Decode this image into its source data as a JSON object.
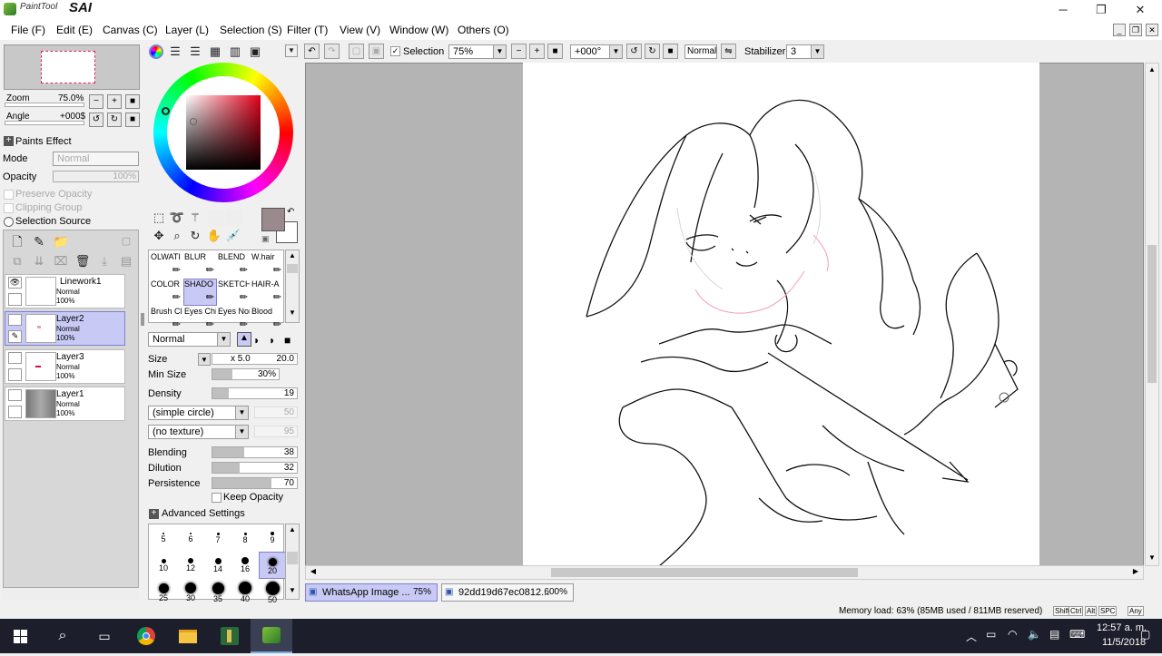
{
  "app": {
    "logo_text": "PaintTool",
    "logo_sai": "SAI"
  },
  "window_controls": {
    "minimize": "─",
    "restore": "❐",
    "close": "✕"
  },
  "menu": [
    {
      "label": "File (F)"
    },
    {
      "label": "Edit (E)"
    },
    {
      "label": "Canvas (C)"
    },
    {
      "label": "Layer (L)"
    },
    {
      "label": "Selection (S)"
    },
    {
      "label": "Filter (T)"
    },
    {
      "label": "View (V)"
    },
    {
      "label": "Window (W)"
    },
    {
      "label": "Others (O)"
    }
  ],
  "navigator": {
    "zoom_label": "Zoom",
    "zoom_value": "75.0%",
    "angle_label": "Angle",
    "angle_value": "+000$"
  },
  "paints_effect": {
    "title": "Paints Effect",
    "mode_label": "Mode",
    "mode_value": "Normal",
    "opacity_label": "Opacity",
    "opacity_value": "100%",
    "preserve_opacity": "Preserve Opacity",
    "clipping_group": "Clipping Group",
    "selection_source": "Selection Source"
  },
  "layers": [
    {
      "name": "Linework1",
      "mode": "Normal",
      "opacity": "100%",
      "selected": false
    },
    {
      "name": "Layer2",
      "mode": "Normal",
      "opacity": "100%",
      "selected": true
    },
    {
      "name": "Layer3",
      "mode": "Normal",
      "opacity": "100%",
      "selected": false
    },
    {
      "name": "Layer1",
      "mode": "Normal",
      "opacity": "100%",
      "selected": false
    }
  ],
  "colors": {
    "primary": "#9a8a8e",
    "secondary": "#ffffff",
    "accent_select": "#c9c9f5",
    "guide_pink": "#e0246a"
  },
  "brushes": [
    [
      "OLWATI",
      "BLUR",
      "BLEND",
      "W.hair"
    ],
    [
      "COLOR",
      "SHADO",
      "SKETCH",
      "HAIR-A"
    ],
    [
      "Brush Cl",
      "Eyes Chibi",
      "Eyes Normal",
      "Blood"
    ]
  ],
  "brush_settings": {
    "blend_mode": "Normal",
    "size_label": "Size",
    "size_mult": "x 5.0",
    "size_value": "20.0",
    "min_size_label": "Min Size",
    "min_size_value": "30%",
    "min_size_fill": 0.3,
    "density_label": "Density",
    "density_value": "19",
    "density_fill": 0.19,
    "shape": "(simple circle)",
    "shape_value": "50",
    "texture": "(no texture)",
    "texture_value": "95",
    "blending_label": "Blending",
    "blending_value": "38",
    "blending_fill": 0.38,
    "dilution_label": "Dilution",
    "dilution_value": "32",
    "dilution_fill": 0.32,
    "persistence_label": "Persistence",
    "persistence_value": "70",
    "persistence_fill": 0.7,
    "keep_opacity": "Keep Opacity",
    "advanced": "Advanced Settings",
    "sizes_row1": [
      "5",
      "6",
      "7",
      "8",
      "9"
    ],
    "sizes_row2": [
      "10",
      "12",
      "14",
      "16",
      "20"
    ],
    "sizes_row3": [
      "25",
      "30",
      "35",
      "40",
      "50"
    ]
  },
  "toolbar": {
    "selection_label": "Selection",
    "zoom_value": "75%",
    "angle_value": "+000°",
    "mode_value": "Normal",
    "stabilizer_label": "Stabilizer",
    "stabilizer_value": "3"
  },
  "doc_tabs": [
    {
      "name": "WhatsApp Image ...",
      "zoom": "75%",
      "active": true
    },
    {
      "name": "92dd19d67ec0812...",
      "zoom": "600%",
      "active": false
    }
  ],
  "status": {
    "memory": "Memory load: 63% (85MB used / 811MB reserved)",
    "keys": [
      "Shift",
      "Ctrl",
      "Alt",
      "SPC",
      "Any"
    ]
  },
  "taskbar": {
    "time": "12:57 a. m.",
    "date": "11/5/2018"
  }
}
